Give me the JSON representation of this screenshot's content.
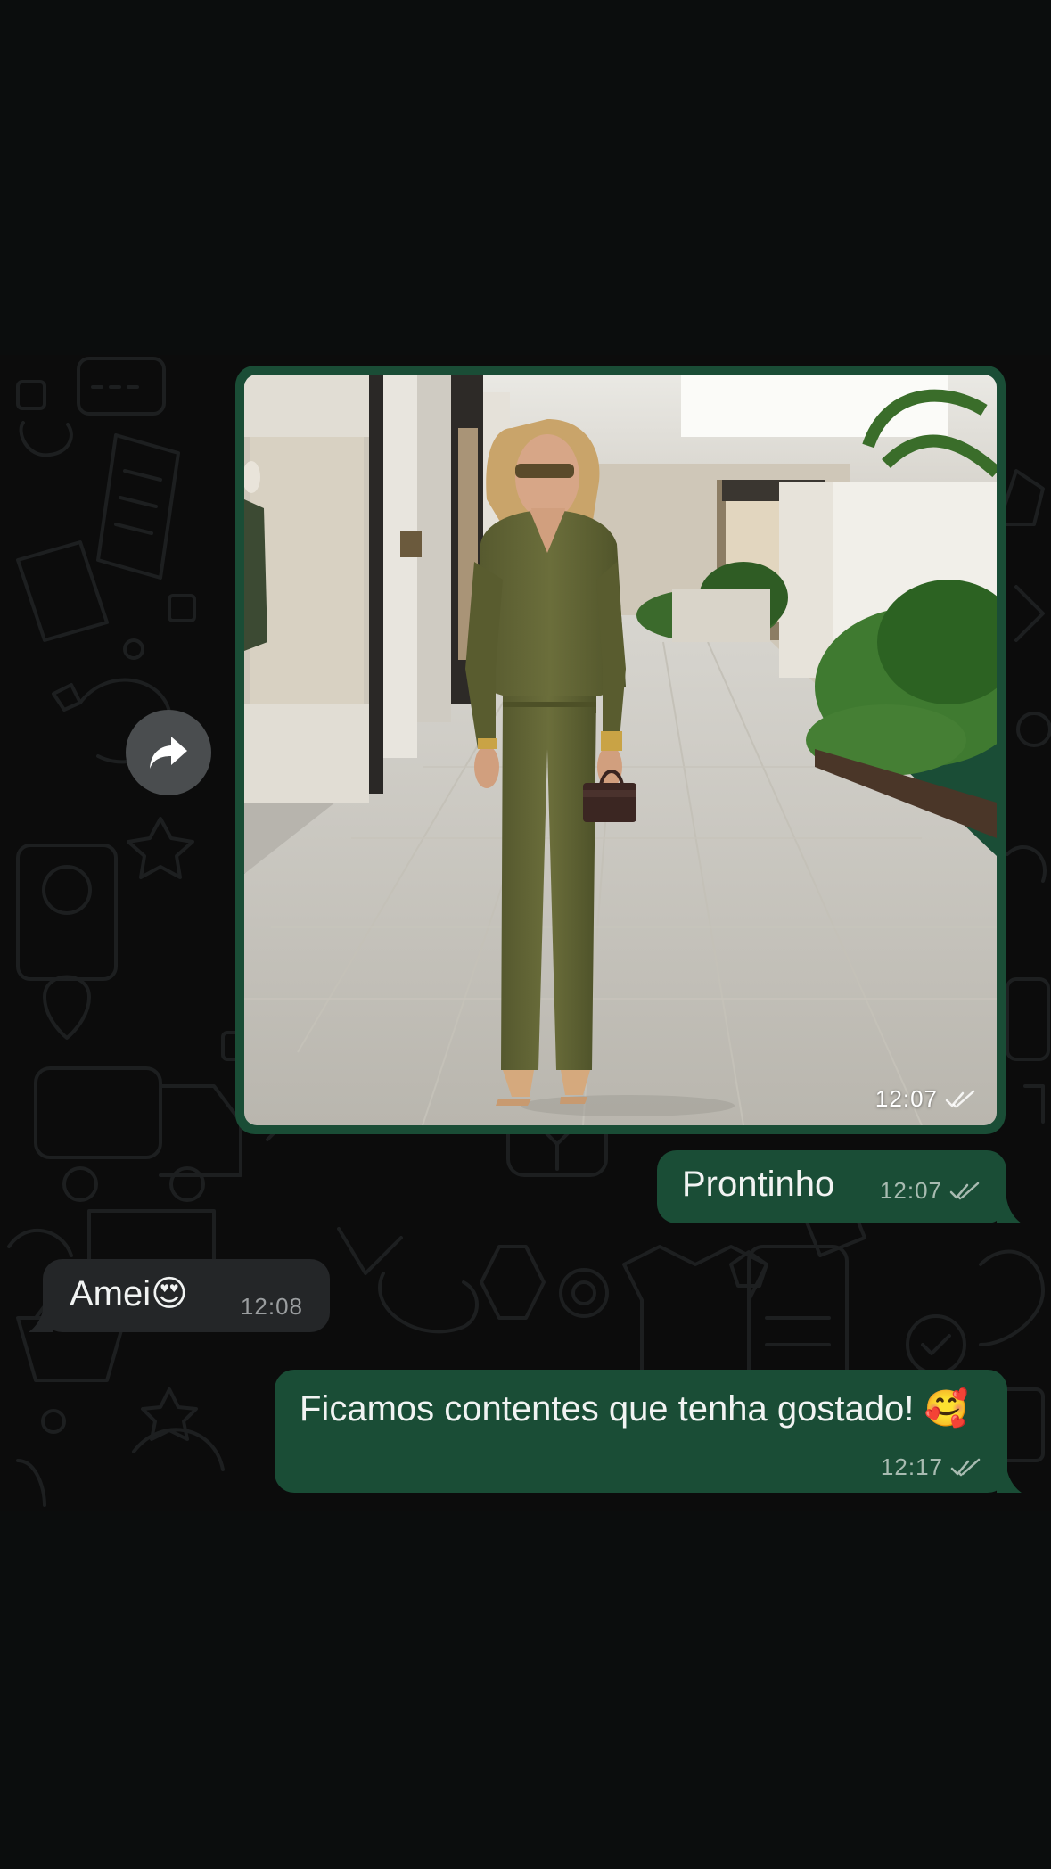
{
  "messages": {
    "image": {
      "time": "12:07",
      "ticks_icon": "double-check-icon"
    },
    "prontinho": {
      "text": "Prontinho",
      "time": "12:07",
      "ticks_icon": "double-check-icon"
    },
    "amei": {
      "text": "Amei😍",
      "time": "12:08"
    },
    "ficamos": {
      "text": "Ficamos contentes que tenha gostado! 🥰",
      "time": "12:17",
      "ticks_icon": "double-check-icon"
    }
  },
  "forward_button": {
    "icon": "forward-arrow-icon"
  },
  "colors": {
    "outgoing_bubble": "#1a4d36",
    "incoming_bubble": "#242628",
    "background": "#0b0d0d",
    "forward_button": "#4a4d4f"
  }
}
